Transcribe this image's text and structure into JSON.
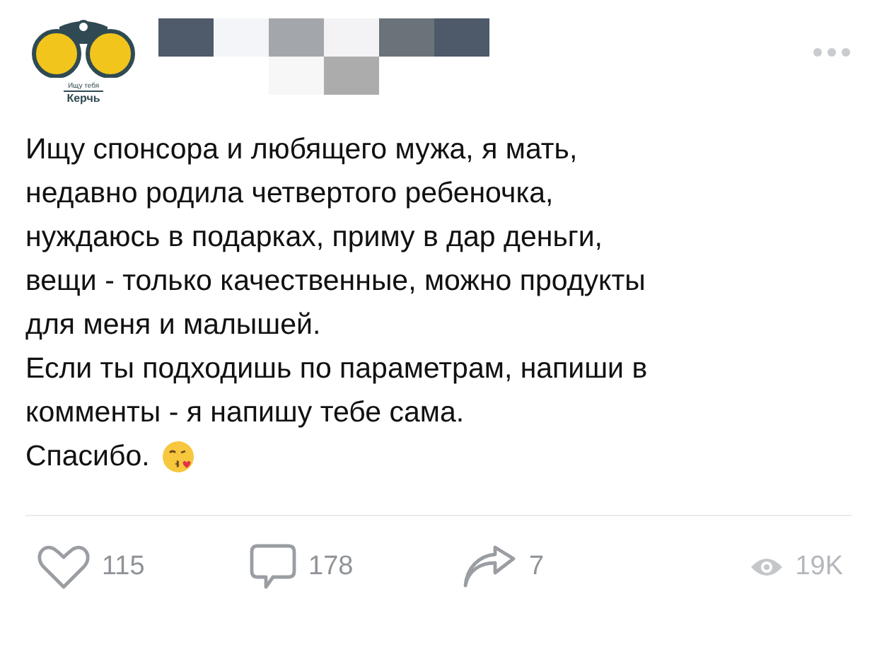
{
  "post": {
    "author_logo": {
      "caption_top": "Ищу тебя",
      "caption_bottom": "Керчь"
    },
    "text_lines": [
      "Ищу спонсора и любящего мужа, я мать,",
      "недавно родила четвертого ребеночка,",
      "нуждаюсь в подарках, приму в дар деньги,",
      "вещи - только качественные, можно продукты",
      "для меня и малышей.",
      "Если ты подходишь по параметрам, напиши в",
      "комменты - я напишу тебе сама.",
      "Спасибо."
    ],
    "actions": [
      {
        "kind": "like",
        "count": "115"
      },
      {
        "kind": "comment",
        "count": "178"
      },
      {
        "kind": "share",
        "count": "7"
      }
    ],
    "views": "19K"
  }
}
